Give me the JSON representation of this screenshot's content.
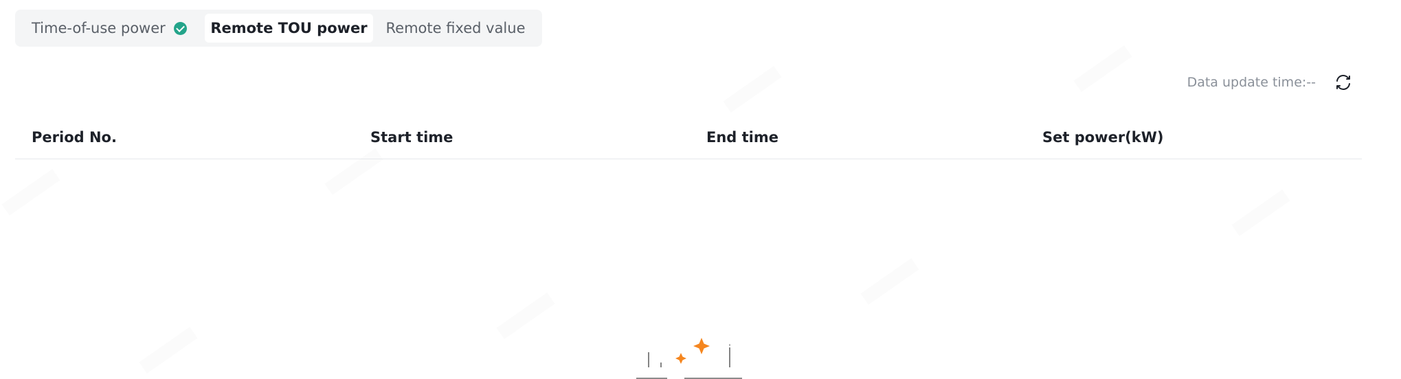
{
  "tabs": [
    {
      "label": "Time-of-use power",
      "checked": true
    },
    {
      "label": "Remote TOU power",
      "active": true
    },
    {
      "label": "Remote fixed value"
    }
  ],
  "update": {
    "label": "Data update time:--",
    "icon": "refresh-icon"
  },
  "table": {
    "columns": [
      "Period No.",
      "Start time",
      "End time",
      "Set power(kW)"
    ],
    "rows": []
  },
  "colors": {
    "check": "#23a48a",
    "accent": "#f5861f"
  }
}
